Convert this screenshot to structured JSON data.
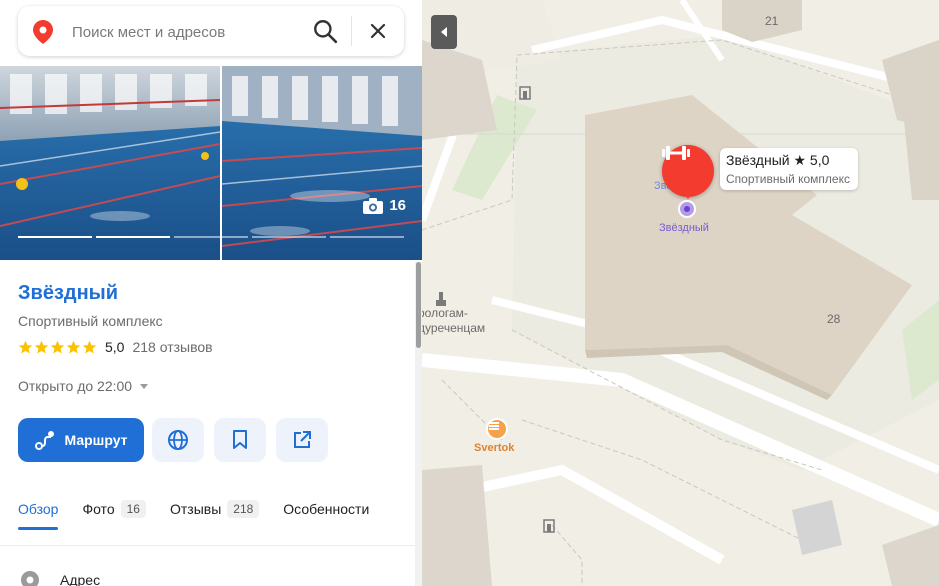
{
  "search": {
    "placeholder": "Поиск мест и адресов"
  },
  "photos": {
    "count": "16"
  },
  "place": {
    "name": "Звёздный",
    "category": "Спортивный комплекс",
    "rating_value": "5,0",
    "rating_stars": 5,
    "reviews": "218 отзывов",
    "hours": "Открыто до 22:00"
  },
  "actions": {
    "route_label": "Маршрут"
  },
  "tabs": [
    {
      "label": "Обзор",
      "badge": ""
    },
    {
      "label": "Фото",
      "badge": "16"
    },
    {
      "label": "Отзывы",
      "badge": "218"
    },
    {
      "label": "Особенности",
      "badge": ""
    }
  ],
  "details": {
    "address_label": "Адрес"
  },
  "map": {
    "tooltip_name": "Звёздный ★ 5,0",
    "tooltip_category": "Спортивный комплекс",
    "poi_label": "Звёздный",
    "poi_ghost_label": "Звездный",
    "building_21": "21",
    "building_28": "28",
    "neighbour_label_1": "ролог­ам-",
    "neighbour_label_2": "дуреченцам",
    "svertok_label": "Svertok"
  },
  "colors": {
    "accent": "#1f6fd6",
    "pin": "#f43b2f",
    "star": "#fcc200"
  }
}
